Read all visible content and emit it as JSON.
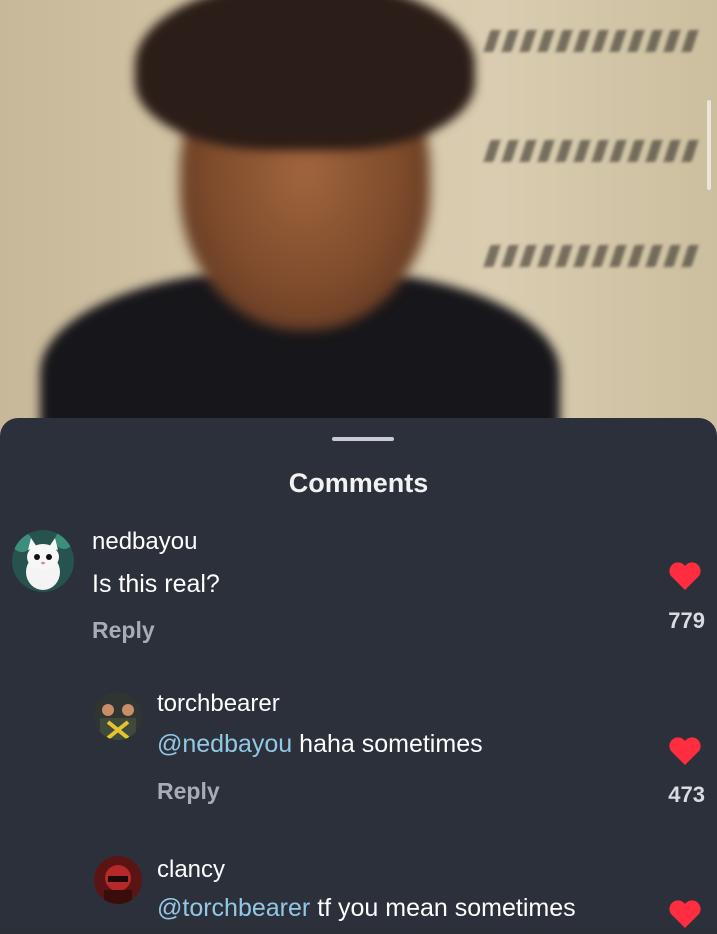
{
  "sheet": {
    "title": "Comments"
  },
  "comments": [
    {
      "username": "nedbayou",
      "mention": "",
      "text": "Is this real?",
      "reply_label": "Reply",
      "like_count": "779",
      "avatar": "white-cat-avatar"
    },
    {
      "username": "torchbearer",
      "mention": "@nedbayou",
      "text": "haha sometimes",
      "reply_label": "Reply",
      "like_count": "473",
      "avatar": "band-photo-avatar"
    },
    {
      "username": "clancy",
      "mention": "@torchbearer",
      "text": "tf you mean sometimes",
      "reply_label": "",
      "like_count": "",
      "avatar": "masked-figure-avatar"
    }
  ],
  "colors": {
    "sheet_background": "#2b303a",
    "mention": "#92c8e6",
    "heart": "#ff2d3f",
    "reply": "#a7acb5"
  }
}
